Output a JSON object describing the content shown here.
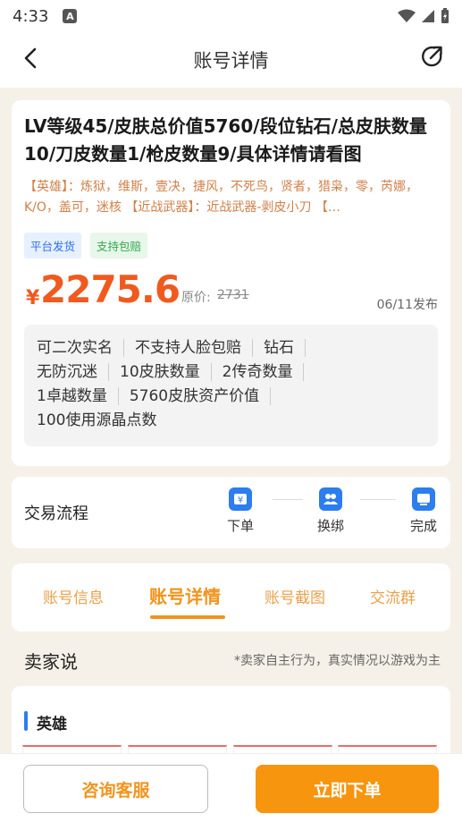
{
  "status_bar": {
    "time": "4:33",
    "a_badge": "A"
  },
  "nav": {
    "title": "账号详情"
  },
  "listing": {
    "title": "LV等级45/皮肤总价值5760/段位钻石/总皮肤数量10/刀皮数量1/枪皮数量9/具体详情请看图",
    "heroes_text": "【英雄】：炼狱，维斯，壹决，捷风，不死鸟，贤者，猎枭，零，芮娜，K/O，盖可，迷核 【近战武器】：近战武器-剥皮小刀 【…",
    "tags": [
      "平台发货",
      "支持包赔"
    ],
    "currency": "¥",
    "price": "2275.6",
    "original_label": "原价:",
    "original_price": "2731",
    "publish_date": "06/11发布",
    "attributes": [
      [
        "可二次实名",
        "不支持人脸包赔",
        "钻石"
      ],
      [
        "无防沉迷",
        "10皮肤数量",
        "2传奇数量"
      ],
      [
        "1卓越数量",
        "5760皮肤资产价值"
      ],
      [
        "100使用源晶点数"
      ]
    ]
  },
  "trade_flow": {
    "title": "交易流程",
    "steps": [
      "下单",
      "换绑",
      "完成"
    ]
  },
  "tabs": [
    "账号信息",
    "账号详情",
    "账号截图",
    "交流群"
  ],
  "seller": {
    "title": "卖家说",
    "note": "*卖家自主行为，真实情况以游戏为主"
  },
  "hero_section": {
    "label": "英雄"
  },
  "bottom": {
    "consult": "咨询客服",
    "order": "立即下单"
  },
  "colors": {
    "accent": "#f2931a",
    "price": "#f05a1f",
    "blue": "#2c7df0"
  }
}
